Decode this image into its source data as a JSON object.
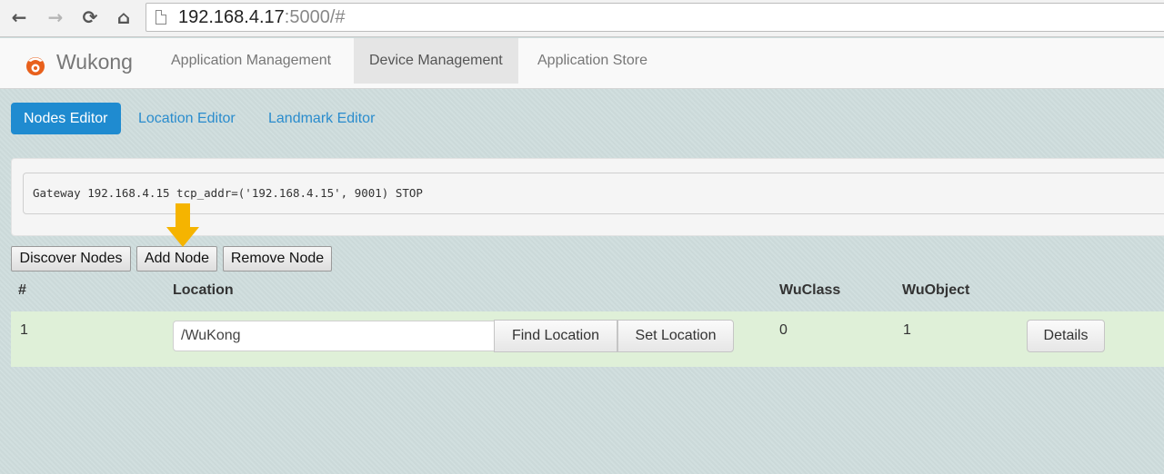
{
  "browser": {
    "url_host": "192.168.4.17",
    "url_rest": ":5000/#"
  },
  "app": {
    "brand": "Wukong",
    "nav": [
      "Application Management",
      "Device Management",
      "Application Store"
    ],
    "active_nav": "Device Management"
  },
  "editor_tabs": {
    "items": [
      "Nodes Editor",
      "Location Editor",
      "Landmark Editor"
    ],
    "active": "Nodes Editor"
  },
  "gateway": {
    "text": "Gateway 192.168.4.15 tcp_addr=('192.168.4.15', 9001) STOP"
  },
  "actions": {
    "discover": "Discover Nodes",
    "add": "Add Node",
    "remove": "Remove Node"
  },
  "table": {
    "headers": [
      "#",
      "Location",
      "WuClass",
      "WuObject"
    ],
    "rows": [
      {
        "id": "1",
        "location": "/WuKong",
        "find_label": "Find Location",
        "set_label": "Set Location",
        "wuclass": "0",
        "wuobject": "1",
        "details_label": "Details"
      }
    ]
  },
  "colors": {
    "accent": "#1f8bd0",
    "row_success": "#dff0d8",
    "arrow": "#f5b400",
    "brand_icon": "#e8601c"
  }
}
